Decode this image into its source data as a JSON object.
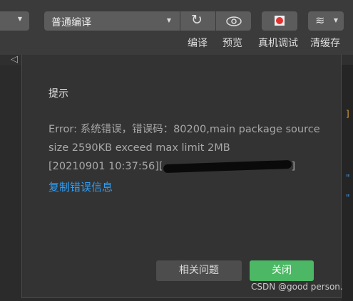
{
  "toolbar": {
    "mode_select": "普通编译",
    "labels": {
      "compile": "编译",
      "preview": "预览",
      "remote_debug": "真机调试",
      "clear_cache": "清缓存"
    }
  },
  "dialog": {
    "title": "提示",
    "message_line1": "Error: 系统错误，错误码：80200,main package source size 2590KB exceed max limit 2MB",
    "message_line2": "[20210901 10:37:56][",
    "message_line3": "]",
    "copy_link": "复制错误信息",
    "related_button": "相关问题",
    "close_button": "关闭"
  },
  "watermark": "CSDN @good person.",
  "colors": {
    "accent_green": "#4cb865",
    "link_blue": "#2e9ef5"
  }
}
